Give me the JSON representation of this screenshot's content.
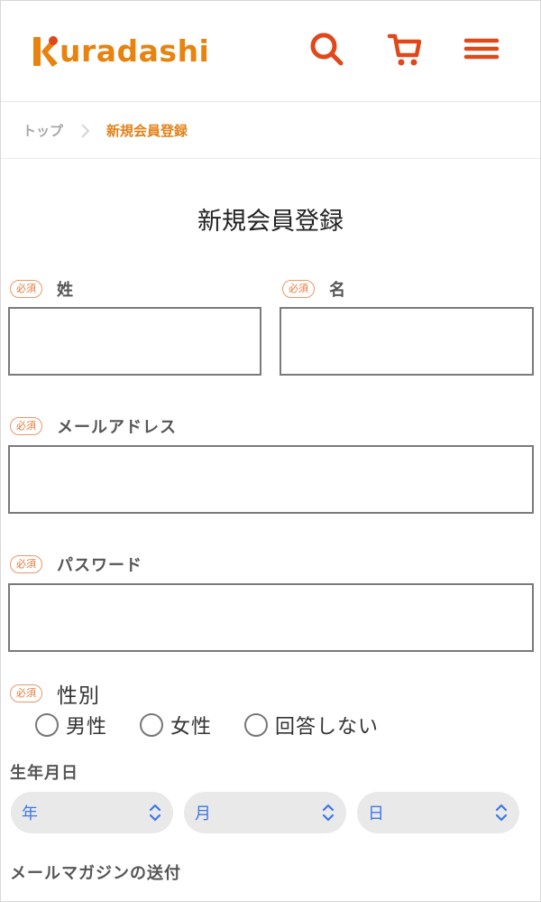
{
  "header": {
    "logo_text": "uradashi",
    "logo_letter": "K",
    "icons": [
      "search-icon",
      "cart-icon",
      "menu-icon"
    ],
    "brand_color": "#e8830f",
    "icon_color": "#e0481c"
  },
  "breadcrumb": {
    "home": "トップ",
    "current": "新規会員登録"
  },
  "form": {
    "title": "新規会員登録",
    "required_badge": "必須",
    "last_name_label": "姓",
    "first_name_label": "名",
    "email_label": "メールアドレス",
    "password_label": "パスワード",
    "gender_label": "性別",
    "gender_options": [
      "男性",
      "女性",
      "回答しない"
    ],
    "birthdate_label": "生年月日",
    "birth_year": "年",
    "birth_month": "月",
    "birth_day": "日",
    "newsletter_label": "メールマガジンの送付"
  }
}
